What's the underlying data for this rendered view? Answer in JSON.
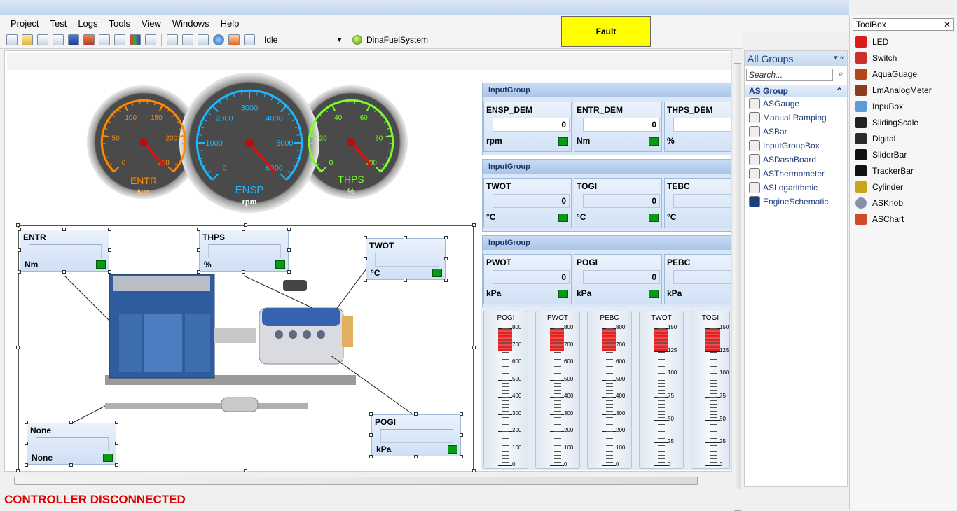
{
  "menu": [
    "Project",
    "Test",
    "Logs",
    "Tools",
    "View",
    "Windows",
    "Help"
  ],
  "toolbar": {
    "mode": "Idle",
    "system_name": "DinaFuelSystem"
  },
  "fault_button": "Fault",
  "gauges": [
    {
      "name": "ENTR",
      "unit": "Nm",
      "ticks": [
        "0",
        "50",
        "100",
        "150",
        "200",
        "250"
      ],
      "color": "#ff8a00"
    },
    {
      "name": "ENSP",
      "unit": "rpm",
      "ticks": [
        "0",
        "1000",
        "2000",
        "3000",
        "4000",
        "5000",
        "6000"
      ],
      "color": "#1ab8ff"
    },
    {
      "name": "THPS",
      "unit": "%",
      "ticks": [
        "0",
        "20",
        "40",
        "60",
        "80",
        "100"
      ],
      "color": "#79ff2a"
    }
  ],
  "input_groups": [
    {
      "title": "InputGroup",
      "cells": [
        {
          "label": "ENSP_DEM",
          "value": "0",
          "unit": "rpm"
        },
        {
          "label": "ENTR_DEM",
          "value": "0",
          "unit": "Nm"
        },
        {
          "label": "THPS_DEM",
          "value": "",
          "unit": "%"
        }
      ]
    },
    {
      "title": "InputGroup",
      "cells": [
        {
          "label": "TWOT",
          "value": "0",
          "unit": "°C"
        },
        {
          "label": "TOGI",
          "value": "0",
          "unit": "°C"
        },
        {
          "label": "TEBC",
          "value": "",
          "unit": "°C"
        }
      ]
    },
    {
      "title": "InputGroup",
      "cells": [
        {
          "label": "PWOT",
          "value": "0",
          "unit": "kPa"
        },
        {
          "label": "POGI",
          "value": "0",
          "unit": "kPa"
        },
        {
          "label": "PEBC",
          "value": "",
          "unit": "kPa"
        }
      ]
    }
  ],
  "schematic_boxes": [
    {
      "label": "ENTR",
      "unit": "Nm"
    },
    {
      "label": "THPS",
      "unit": "%"
    },
    {
      "label": "TWOT",
      "unit": "°C"
    },
    {
      "label": "None",
      "unit": "None"
    },
    {
      "label": "POGI",
      "unit": "kPa"
    }
  ],
  "scales": [
    {
      "name": "POGI",
      "ticks": [
        "800",
        "700",
        "600",
        "500",
        "400",
        "300",
        "200",
        "100",
        "0"
      ],
      "fill": 0.17
    },
    {
      "name": "PWOT",
      "ticks": [
        "800",
        "700",
        "600",
        "500",
        "400",
        "300",
        "200",
        "100",
        "0"
      ],
      "fill": 0.17
    },
    {
      "name": "PEBC",
      "ticks": [
        "800",
        "700",
        "600",
        "500",
        "400",
        "300",
        "200",
        "100",
        "0"
      ],
      "fill": 0.17
    },
    {
      "name": "TWOT",
      "ticks": [
        "150",
        "125",
        "100",
        "75",
        "50",
        "25",
        "0"
      ],
      "fill": 0.17
    },
    {
      "name": "TOGI",
      "ticks": [
        "150",
        "125",
        "100",
        "75",
        "50",
        "25",
        "0"
      ],
      "fill": 0.17
    }
  ],
  "groups_panel": {
    "title": "All Groups",
    "search_placeholder": "Search...",
    "group_name": "AS Group",
    "items": [
      "ASGauge",
      "Manual Ramping",
      "ASBar",
      "InputGroupBox",
      "ASDashBoard",
      "ASThermometer",
      "ASLogarithmic",
      "EngineSchematic"
    ]
  },
  "toolbox": {
    "title": "ToolBox",
    "items": [
      "LED",
      "Switch",
      "AquaGuage",
      "LmAnalogMeter",
      "InpuBox",
      "SlidingScale",
      "Digital",
      "SliderBar",
      "TrackerBar",
      "Cylinder",
      "ASKnob",
      "ASChart"
    ]
  },
  "status": "CONTROLLER DISCONNECTED"
}
